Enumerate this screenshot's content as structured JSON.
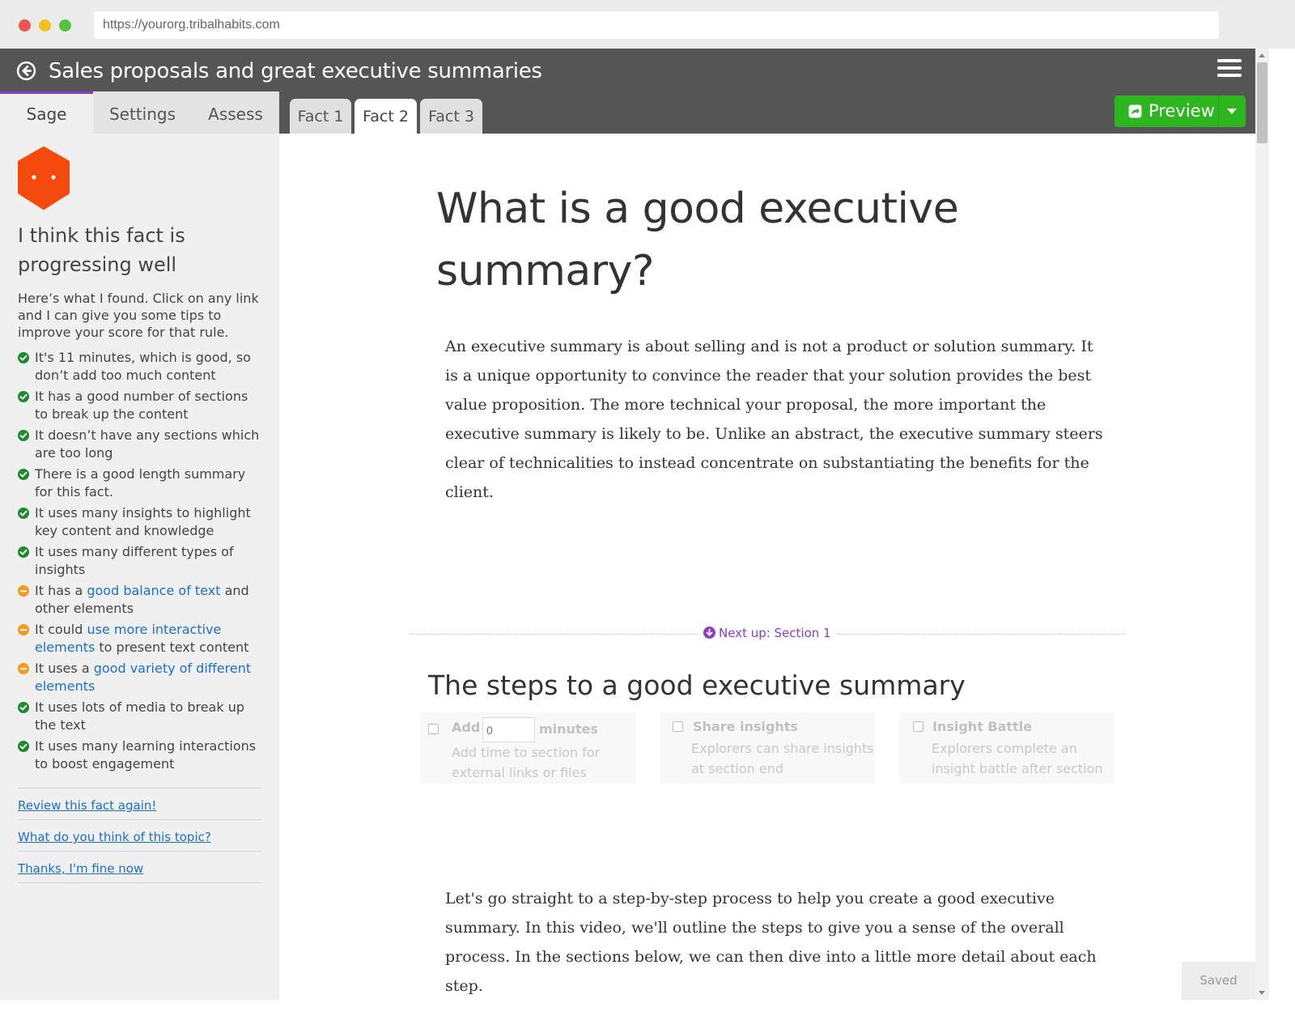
{
  "browser": {
    "url": "https://yourorg.tribalhabits.com"
  },
  "header": {
    "course_title": "Sales proposals and great executive summaries",
    "back_icon": "back-arrow-circle-icon",
    "menu_icon": "hamburger-menu-icon"
  },
  "left_tabs": [
    {
      "label": "Sage",
      "active": true
    },
    {
      "label": "Settings",
      "active": false
    },
    {
      "label": "Assess",
      "active": false
    }
  ],
  "fact_tabs": [
    {
      "label": "Fact 1",
      "active": false
    },
    {
      "label": "Fact 2",
      "active": true
    },
    {
      "label": "Fact 3",
      "active": false
    }
  ],
  "preview": {
    "label": "Preview",
    "color": "#2db61f"
  },
  "sage": {
    "heading": "I think this fact is progressing well",
    "intro": "Here’s what I found. Click on any link and I can give you some tips to improve your score for that rule.",
    "rules": [
      {
        "status": "good",
        "text": "It's 11 minutes, which is good, so don’t add too much content"
      },
      {
        "status": "good",
        "text": "It has a good number of sections to break up the content"
      },
      {
        "status": "good",
        "text": "It doesn’t have any sections which are too long"
      },
      {
        "status": "good",
        "text": "There is a good length summary for this fact."
      },
      {
        "status": "good",
        "text": "It uses many insights to highlight key content and knowledge"
      },
      {
        "status": "good",
        "text": "It uses many different types of insights"
      },
      {
        "status": "warn",
        "before": "It has a ",
        "link": "good balance of text",
        "after": " and other elements"
      },
      {
        "status": "warn",
        "before": "It could ",
        "link": "use more interactive elements",
        "after": " to present text content"
      },
      {
        "status": "warn",
        "before": "It uses a ",
        "link": "good variety of different elements",
        "after": ""
      },
      {
        "status": "good",
        "text": "It uses lots of media to break up the text"
      },
      {
        "status": "good",
        "text": "It uses many learning interactions to boost engagement"
      }
    ],
    "links": [
      "Review this fact again!",
      "What do you think of this topic?",
      "Thanks, I'm fine now"
    ],
    "colors": {
      "good": "#1e8a2e",
      "warn": "#f59a1b",
      "avatar": "#f44a0e",
      "link": "#1a6fd0"
    }
  },
  "content": {
    "fact_title": "What is a good executive summary?",
    "summary": "An executive summary is about selling and is not a product or solution summary. It is a unique opportunity to convince the reader that your solution provides the best value proposition. The more technical your proposal, the more important the executive summary is likely to be. Unlike an abstract, the executive summary steers clear of technicalities to instead concentrate on substantiating the benefits for the client.",
    "next_up": "Next up: Section 1",
    "section_title": "The steps to a good executive summary",
    "options": {
      "add_label": "Add",
      "minutes_placeholder": "0",
      "minutes_label": "minutes",
      "add_desc": "Add time to section for external links or files",
      "share_title": "Share insights",
      "share_desc": "Explorers can share insights at section end",
      "battle_title": "Insight Battle",
      "battle_desc": "Explorers complete an insight battle after section"
    },
    "section_text": "Let's go straight to a step-by-step process to help you create a good executive summary. In this video, we'll outline the steps to give you a sense of the overall process. In the sections below, we can then dive into a little more detail about each step.",
    "saved": "Saved",
    "accent": "#8e3bc4"
  }
}
